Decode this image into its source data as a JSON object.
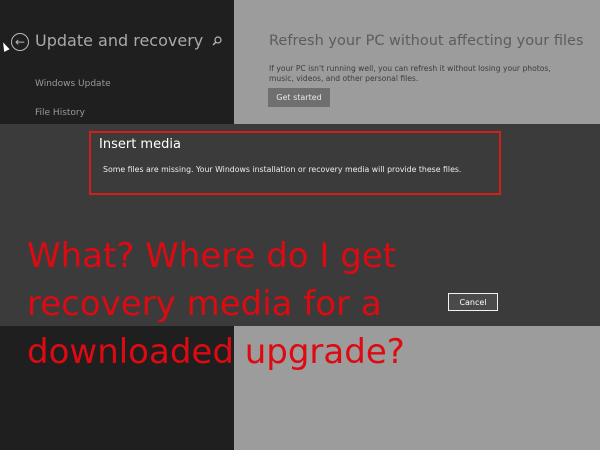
{
  "sidebar": {
    "back_glyph": "←",
    "title": "Update and recovery",
    "items": [
      {
        "label": "Windows Update"
      },
      {
        "label": "File History"
      }
    ]
  },
  "main": {
    "title": "Refresh your PC without affecting your files",
    "description": "If your PC isn't running well, you can refresh it without losing your photos, music, videos, and other personal files.",
    "get_started_label": "Get started"
  },
  "dialog": {
    "title": "Insert media",
    "message": "Some files are missing. Your Windows installation or recovery media will provide these files.",
    "cancel_label": "Cancel"
  },
  "annotation": {
    "text": "What? Where do I get\nrecovery media for a\ndownloaded upgrade?",
    "color": "#dd0a12"
  },
  "colors": {
    "sidebar_bg": "#1f1f1f",
    "main_bg": "#9c9c9c",
    "dialog_bg": "#3b3b3b",
    "highlight": "#d0201b"
  },
  "icons": [
    "back-arrow-icon",
    "search-icon",
    "mouse-cursor-icon"
  ]
}
